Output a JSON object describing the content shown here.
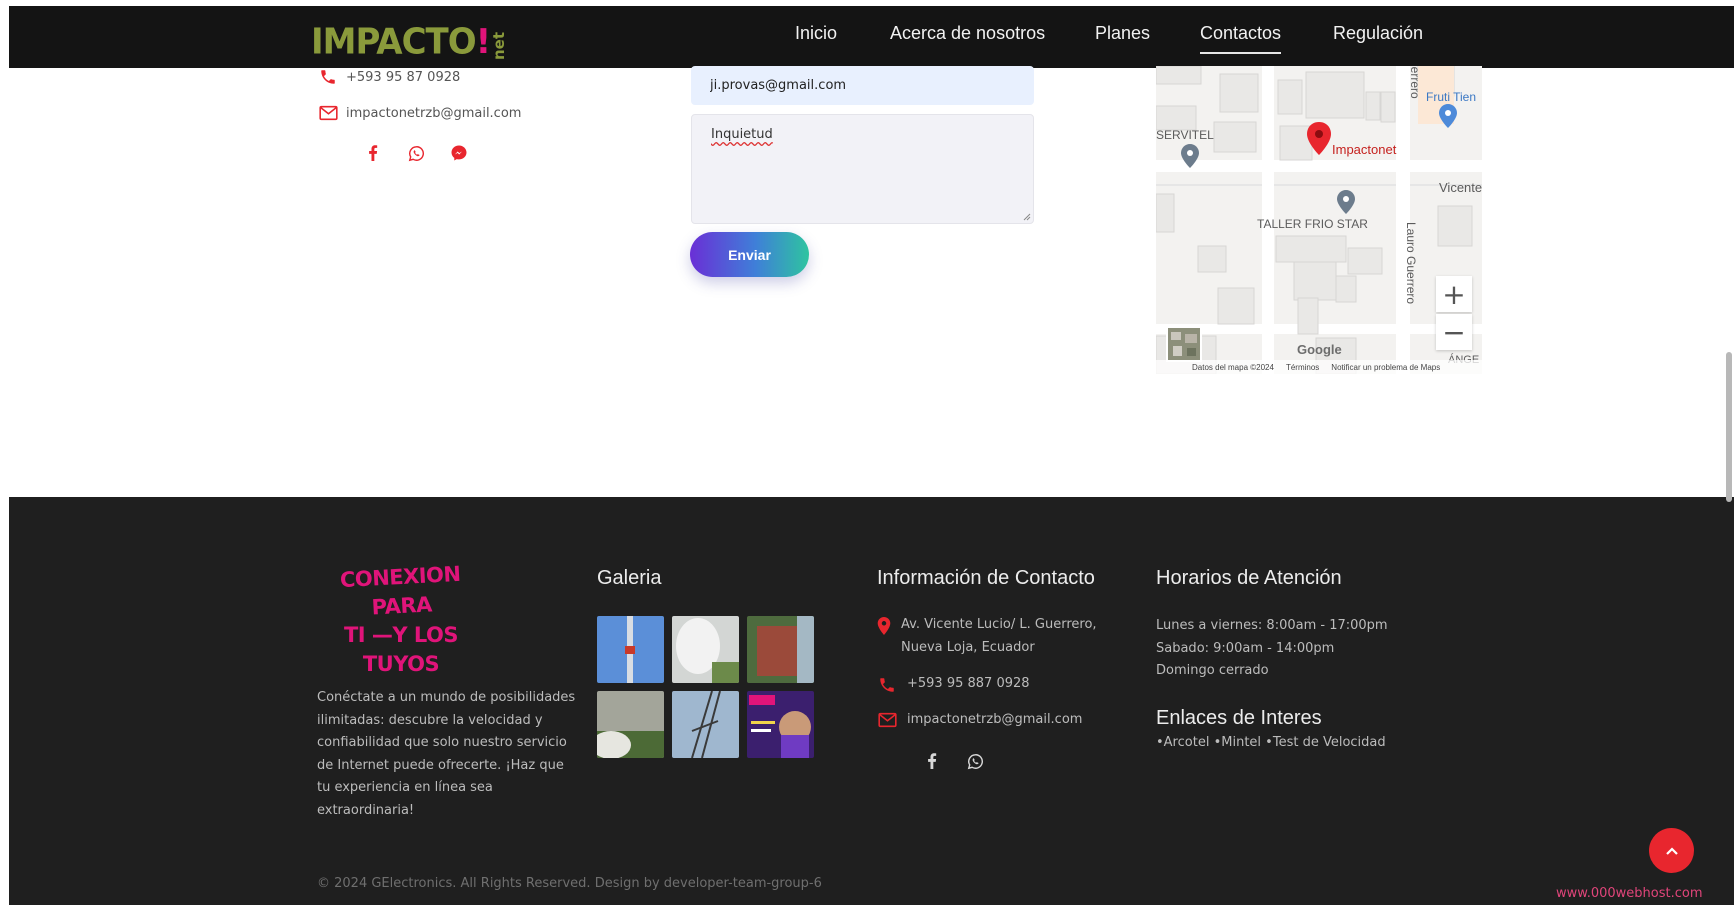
{
  "nav": {
    "logo_main": "IMPACTO",
    "logo_excl": "!",
    "logo_suffix": "net",
    "links": [
      "Inicio",
      "Acerca de nosotros",
      "Planes",
      "Contactos",
      "Regulación"
    ],
    "active": "Contactos"
  },
  "contact": {
    "phone": "+593 95 87 0928",
    "email": "impactonetrzb@gmail.com",
    "social": [
      "facebook-icon",
      "whatsapp-icon",
      "messenger-icon"
    ]
  },
  "form": {
    "email_value": "ji.provas@gmail.com",
    "message_value": "Inquietud",
    "submit_label": "Enviar"
  },
  "map": {
    "labels": {
      "servitel": "SERVITEL",
      "impactonet": "Impactonet",
      "frutitienda": "Fruti Tien",
      "vicente": "Vicente",
      "taller": "TALLER FRIO STAR",
      "lauro": "Lauro Guerrero",
      "guerrero_top": "uerrero",
      "angel": "ÁNGE"
    },
    "zoom_in": "+",
    "zoom_out": "−",
    "google": "Google",
    "footer": [
      "Datos del mapa ©2024",
      "Términos",
      "Notificar un problema de Maps"
    ]
  },
  "footer": {
    "slogan": [
      "CONEXION PARA",
      "TI —Y LOS",
      "TUYOS"
    ],
    "paragraph": "Conéctate a un mundo de posibilidades ilimitadas: descubre la velocidad y confiabilidad que solo nuestro servicio de Internet puede ofrecerte. ¡Haz que tu experiencia en línea sea extraordinaria!",
    "gallery_title": "Galeria",
    "contact_title": "Información de Contacto",
    "address": "Av. Vicente Lucio/ L. Guerrero, Nueva Loja, Ecuador",
    "phone": "+593 95 887 0928",
    "email": "impactonetrzb@gmail.com",
    "hours_title": "Horarios de Atención",
    "hours": [
      "Lunes a viernes: 8:00am - 17:00pm",
      "Sabado: 9:00am - 14:00pm",
      "Domingo cerrado"
    ],
    "links_title": "Enlaces de Interes",
    "links": [
      "•Arcotel",
      "•Mintel",
      "•Test de Velocidad"
    ],
    "copyright": "© 2024 GElectronics. All Rights Reserved. Design by developer-team-group-6",
    "badge": "www.000webhost.com"
  },
  "colors": {
    "nav_bg": "#141414",
    "footer_bg": "#1f1f1f",
    "accent_red": "#e8262e",
    "accent_pink": "#e0147a",
    "logo_green": "#8a9a3b"
  }
}
